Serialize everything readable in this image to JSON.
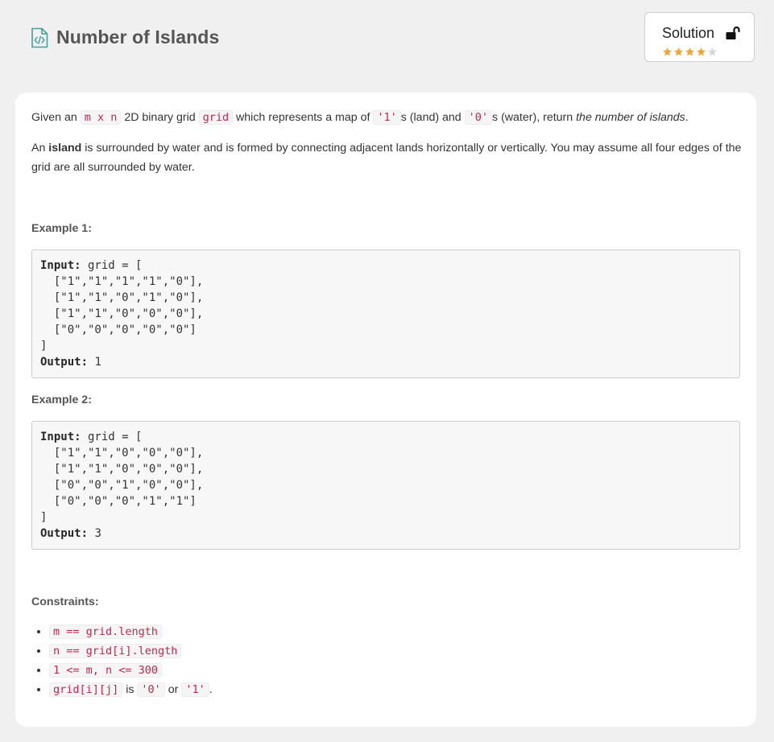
{
  "header": {
    "title": "Number of Islands",
    "solution_label": "Solution",
    "rating": 4,
    "rating_max": 5,
    "colors": {
      "star_filled": "#f0a43a",
      "star_empty": "#d6d6d6",
      "icon": "#4a9e9e"
    }
  },
  "description": {
    "p1": {
      "t1": "Given an ",
      "code1": "m x n",
      "t2": " 2D binary grid ",
      "code2": "grid",
      "t3": " which represents a map of ",
      "code3": "'1'",
      "t4": "s (land) and ",
      "code4": "'0'",
      "t5": "s (water), return ",
      "em": "the number of islands",
      "t6": "."
    },
    "p2": {
      "t1": "An ",
      "strong": "island",
      "t2": " is surrounded by water and is formed by connecting adjacent lands horizontally or vertically. You may assume all four edges of the grid are all surrounded by water."
    }
  },
  "examples": [
    {
      "title": "Example 1:",
      "input_label": "Input:",
      "input_lines": [
        " grid = [",
        "  [\"1\",\"1\",\"1\",\"1\",\"0\"],",
        "  [\"1\",\"1\",\"0\",\"1\",\"0\"],",
        "  [\"1\",\"1\",\"0\",\"0\",\"0\"],",
        "  [\"0\",\"0\",\"0\",\"0\",\"0\"]",
        "]"
      ],
      "output_label": "Output:",
      "output_value": " 1"
    },
    {
      "title": "Example 2:",
      "input_label": "Input:",
      "input_lines": [
        " grid = [",
        "  [\"1\",\"1\",\"0\",\"0\",\"0\"],",
        "  [\"1\",\"1\",\"0\",\"0\",\"0\"],",
        "  [\"0\",\"0\",\"1\",\"0\",\"0\"],",
        "  [\"0\",\"0\",\"0\",\"1\",\"1\"]",
        "]"
      ],
      "output_label": "Output:",
      "output_value": " 3"
    }
  ],
  "constraints": {
    "title": "Constraints:",
    "items": [
      {
        "code": "m == grid.length"
      },
      {
        "code": "n == grid[i].length"
      },
      {
        "code": "1 <= m, n <= 300"
      },
      {
        "code": "grid[i][j]",
        "t1": " is ",
        "code2": "'0'",
        "t2": " or ",
        "code3": "'1'",
        "t3": "."
      }
    ]
  }
}
